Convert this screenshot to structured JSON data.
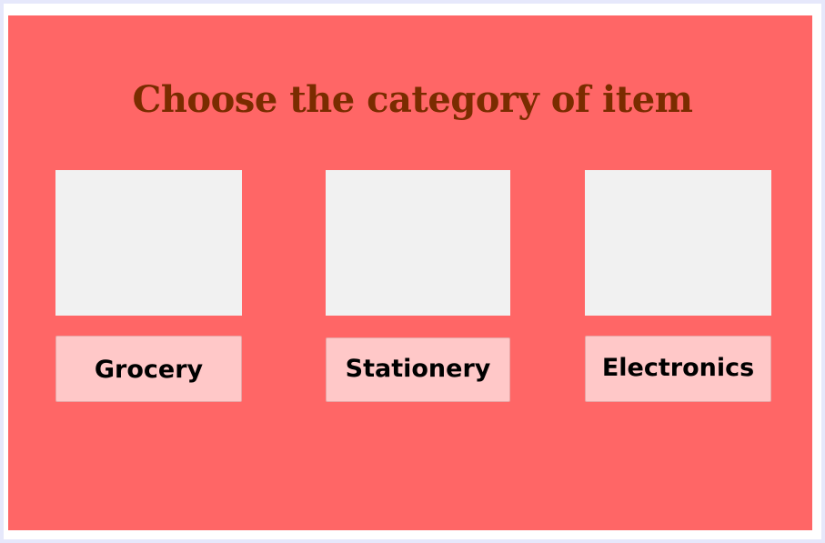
{
  "page": {
    "title": "Choose the category of item"
  },
  "categories": [
    {
      "label": "Grocery"
    },
    {
      "label": "Stationery"
    },
    {
      "label": "Electronics"
    }
  ],
  "colors": {
    "background": "#e6e8fb",
    "panel": "#ff6666",
    "title": "#7a2c00",
    "image_placeholder": "#f1f1f1",
    "button": "#ffc8c8"
  }
}
